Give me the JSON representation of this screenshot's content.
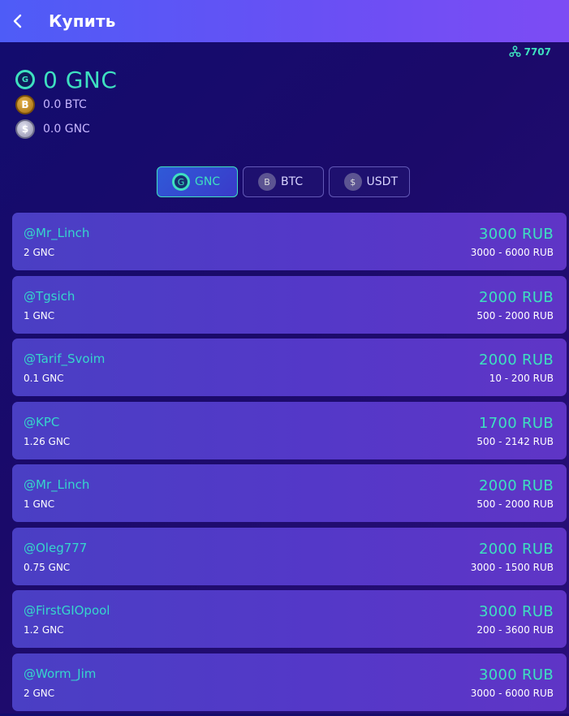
{
  "header": {
    "title": "Купить",
    "back_icon": "chevron-left-icon"
  },
  "referral": {
    "icon": "network-icon",
    "count": "7707"
  },
  "balances": {
    "main": {
      "value": "0 GNC",
      "icon": "gnc-coin-icon"
    },
    "btc": {
      "value": "0.0 BTC",
      "icon": "btc-coin-icon",
      "letter": "B"
    },
    "gnc": {
      "value": "0.0 GNC",
      "icon": "dollar-coin-icon",
      "letter": "$"
    }
  },
  "main_coin_letter": "G",
  "tabs": [
    {
      "label": "GNC",
      "letter": "G",
      "active": true
    },
    {
      "label": "BTC",
      "letter": "B",
      "active": false
    },
    {
      "label": "USDT",
      "letter": "$",
      "active": false
    }
  ],
  "offers": [
    {
      "user": "@Mr_Linch",
      "amount": "2 GNC",
      "price": "3000 RUB",
      "range": "3000 - 6000 RUB"
    },
    {
      "user": "@Tgsich",
      "amount": "1 GNC",
      "price": "2000 RUB",
      "range": "500 - 2000 RUB"
    },
    {
      "user": "@Tarif_Svoim",
      "amount": "0.1 GNC",
      "price": "2000 RUB",
      "range": "10 - 200 RUB"
    },
    {
      "user": "@KPC",
      "amount": "1.26 GNC",
      "price": "1700 RUB",
      "range": "500 - 2142 RUB"
    },
    {
      "user": "@Mr_Linch",
      "amount": "1 GNC",
      "price": "2000 RUB",
      "range": "500 - 2000 RUB"
    },
    {
      "user": "@Oleg777",
      "amount": "0.75 GNC",
      "price": "2000 RUB",
      "range": "3000 - 1500 RUB"
    },
    {
      "user": "@FirstGIOpool",
      "amount": "1.2 GNC",
      "price": "3000 RUB",
      "range": "200 - 3600 RUB"
    },
    {
      "user": "@Worm_Jim",
      "amount": "2 GNC",
      "price": "3000 RUB",
      "range": "3000 - 6000 RUB"
    }
  ],
  "colors": {
    "accent": "#3ee0c0",
    "header_start": "#4e5cf7",
    "header_end": "#7d4cf4",
    "card": "#5438c8"
  }
}
